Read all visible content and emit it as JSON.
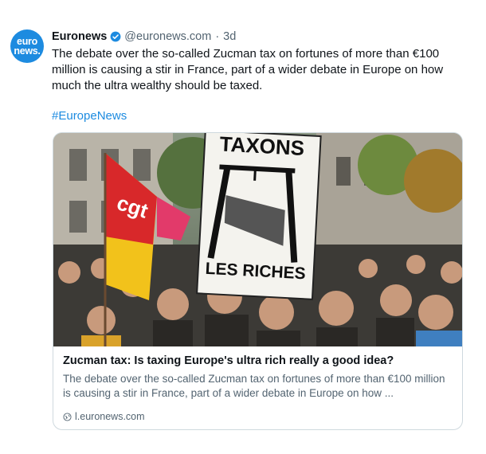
{
  "post": {
    "avatar_text_line1": "euro",
    "avatar_text_line2": "news.",
    "author_name": "Euronews",
    "handle": "@euronews.com",
    "separator": "·",
    "time": "3d",
    "text": "The debate over the so-called Zucman tax on fortunes of more than €100 million is causing a stir in France, part of a wider debate in Europe on how much the ultra wealthy should be taxed.",
    "hashtag": "#EuropeNews",
    "verified_icon": "verified-badge-icon"
  },
  "card": {
    "image_sign_top": "TAXONS",
    "image_sign_bottom": "LES RICHES",
    "image_flag_text": "cgt",
    "title": "Zucman tax: Is taxing Europe's ultra rich really a good idea?",
    "description": "The debate over the so-called Zucman tax on fortunes of more than €100 million is causing a stir in France, part of a wider debate in Europe on how ...",
    "link": "l.euronews.com",
    "link_icon": "globe-icon"
  },
  "colors": {
    "brand": "#1d8be0",
    "text": "#0f1419",
    "muted": "#536471",
    "border": "#cfd9de"
  }
}
